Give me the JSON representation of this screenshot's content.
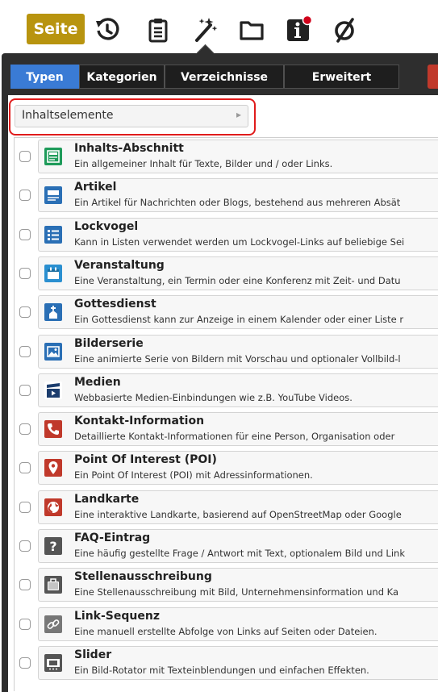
{
  "toolbar": {
    "page_button": "Seite",
    "icons": [
      "history-icon",
      "clipboard-icon",
      "magic-wand-icon",
      "folder-icon",
      "info-icon",
      "empty-set-icon"
    ],
    "colors": {
      "page_button": "#b8940f",
      "notification_dot": "#d0021b"
    }
  },
  "tabs": [
    {
      "label": "Typen",
      "active": true
    },
    {
      "label": "Kategorien",
      "active": false
    },
    {
      "label": "Verzeichnisse",
      "active": false
    },
    {
      "label": "Erweitert",
      "active": false
    }
  ],
  "selector": {
    "value": "Inhaltselemente"
  },
  "items": [
    {
      "title": "Inhalts-Abschnitt",
      "desc": "Ein allgemeiner Inhalt für Texte, Bilder und / oder Links.",
      "icon": "content-section-icon",
      "color": "#1e9b5a"
    },
    {
      "title": "Artikel",
      "desc": "Ein Artikel für Nachrichten oder Blogs, bestehend aus mehreren Absät",
      "icon": "article-icon",
      "color": "#2a6fb5"
    },
    {
      "title": "Lockvogel",
      "desc": "Kann in Listen verwendet werden um Lockvogel-Links auf beliebige Sei",
      "icon": "list-icon",
      "color": "#2a6fb5"
    },
    {
      "title": "Veranstaltung",
      "desc": "Eine Veranstaltung, ein Termin oder eine Konferenz mit Zeit- und Datu",
      "icon": "calendar-icon",
      "color": "#2a8fd0"
    },
    {
      "title": "Gottesdienst",
      "desc": "Ein Gottesdienst kann zur Anzeige in einem Kalender oder einer Liste r",
      "icon": "church-icon",
      "color": "#2a6fb5"
    },
    {
      "title": "Bilderserie",
      "desc": "Eine animierte Serie von Bildern mit Vorschau und optionaler Vollbild-l",
      "icon": "image-series-icon",
      "color": "#2a6fb5"
    },
    {
      "title": "Medien",
      "desc": "Webbasierte Medien-Einbindungen wie z.B. YouTube Videos.",
      "icon": "media-icon",
      "color": "#1c3d6e"
    },
    {
      "title": "Kontakt-Information",
      "desc": "Detaillierte Kontakt-Informationen für eine Person, Organisation oder",
      "icon": "phone-icon",
      "color": "#c0392b"
    },
    {
      "title": "Point Of Interest (POI)",
      "desc": "Ein Point Of Interest (POI) mit Adressinformationen.",
      "icon": "map-pin-icon",
      "color": "#c0392b"
    },
    {
      "title": "Landkarte",
      "desc": "Eine interaktive Landkarte, basierend auf OpenStreetMap oder Google",
      "icon": "globe-icon",
      "color": "#c0392b"
    },
    {
      "title": "FAQ-Eintrag",
      "desc": "Eine häufig gestellte Frage / Antwort mit Text, optionalem Bild und Link",
      "icon": "question-icon",
      "color": "#555555"
    },
    {
      "title": "Stellenausschreibung",
      "desc": "Eine Stellenausschreibung mit Bild, Unternehmensinformation und Ka",
      "icon": "briefcase-icon",
      "color": "#555555"
    },
    {
      "title": "Link-Sequenz",
      "desc": "Eine manuell erstellte Abfolge von Links auf Seiten oder Dateien.",
      "icon": "link-icon",
      "color": "#777777"
    },
    {
      "title": "Slider",
      "desc": "Ein Bild-Rotator mit Texteinblendungen und einfachen Effekten.",
      "icon": "slider-icon",
      "color": "#555555"
    }
  ]
}
